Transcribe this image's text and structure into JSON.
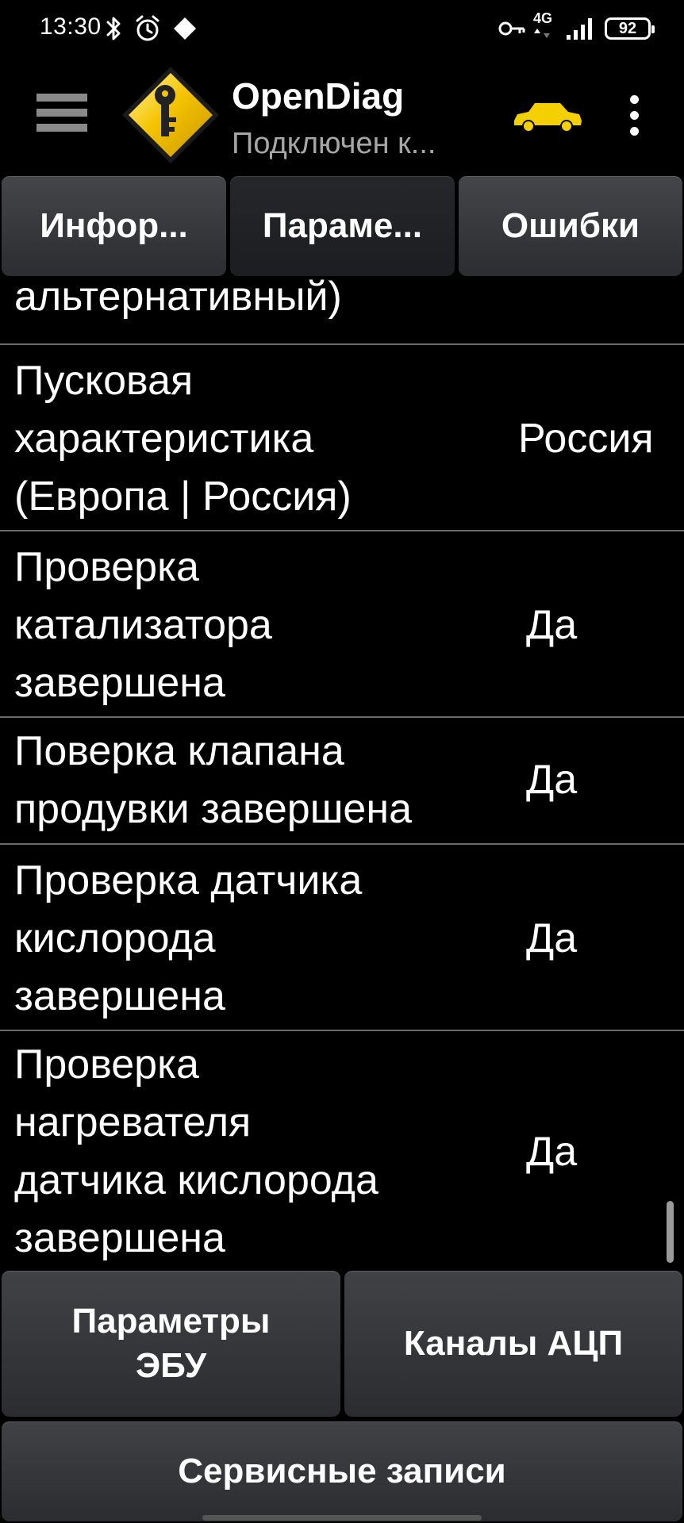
{
  "status_bar": {
    "time": "13:30",
    "battery": "92",
    "network": "4G",
    "icons": [
      "bluetooth-icon",
      "alarm-icon",
      "location-icon",
      "vpn-key-icon",
      "signal-icon",
      "battery-icon"
    ]
  },
  "app_bar": {
    "title": "OpenDiag",
    "subtitle": "Подключен к...",
    "icons": [
      "menu-icon",
      "app-logo-icon",
      "car-icon",
      "more-vert-icon"
    ]
  },
  "tabs": [
    {
      "label": "Инфор...",
      "selected": false
    },
    {
      "label": "Параме...",
      "selected": true
    },
    {
      "label": "Ошибки",
      "selected": false
    }
  ],
  "params": [
    {
      "name": "альтернативный)",
      "value": ""
    },
    {
      "name": "Пусковая\nхарактеристика\n(Европа | Россия)",
      "value": "Россия"
    },
    {
      "name": "Проверка\nкатализатора\nзавершена",
      "value": "Да"
    },
    {
      "name": "Поверка клапана\nпродувки завершена",
      "value": "Да"
    },
    {
      "name": "Проверка датчика\nкислорода\nзавершена",
      "value": "Да"
    },
    {
      "name": "Проверка\nнагревателя\nдатчика кислорода\nзавершена",
      "value": "Да"
    }
  ],
  "bottom_buttons": {
    "ecu_params": "Параметры\nЭБУ",
    "adc_channels": "Каналы АЦП",
    "service_records": "Сервисные записи"
  },
  "colors": {
    "background": "#000000",
    "tab_gradient_top": "#434549",
    "tab_gradient_bottom": "#2c2d30",
    "divider": "#6b6b6b",
    "subtitle": "#a6a6a6",
    "logo_yellow": "#f5c400",
    "car_yellow": "#f5d000"
  }
}
